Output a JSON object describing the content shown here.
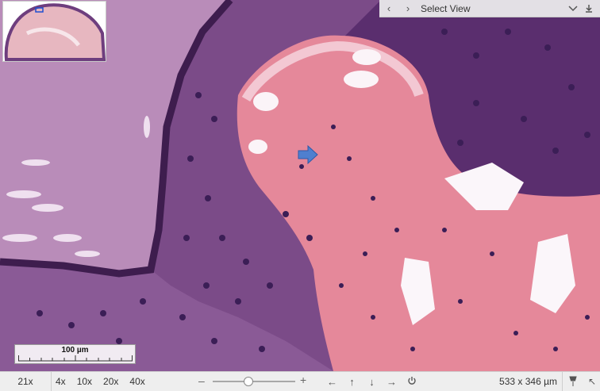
{
  "viewer": {
    "view_title": "Select View",
    "current_zoom": "21x",
    "zoom_presets": [
      "4x",
      "10x",
      "20x",
      "40x"
    ],
    "scalebar_label": "100 µm",
    "field_dimensions": "533 x 346 µm",
    "slider_minus": "–",
    "slider_plus": "+",
    "slider_level": 0.42
  },
  "icons": {
    "prev": "chevron-left-icon",
    "next": "chevron-right-icon",
    "collapse": "chevron-down-icon",
    "download": "download-icon",
    "pan_left": "arrow-left-icon",
    "pan_up": "arrow-up-icon",
    "pan_down": "arrow-down-icon",
    "pan_right": "arrow-right-icon",
    "reset": "power-icon",
    "pin": "pin-icon",
    "corner": "resize-corner-icon"
  },
  "colors": {
    "stain_purple": "#6e3e7e",
    "stain_pink": "#e27f93",
    "marker_arrow": "#4f7fcf",
    "toolbar_bg": "#eeeeee"
  }
}
